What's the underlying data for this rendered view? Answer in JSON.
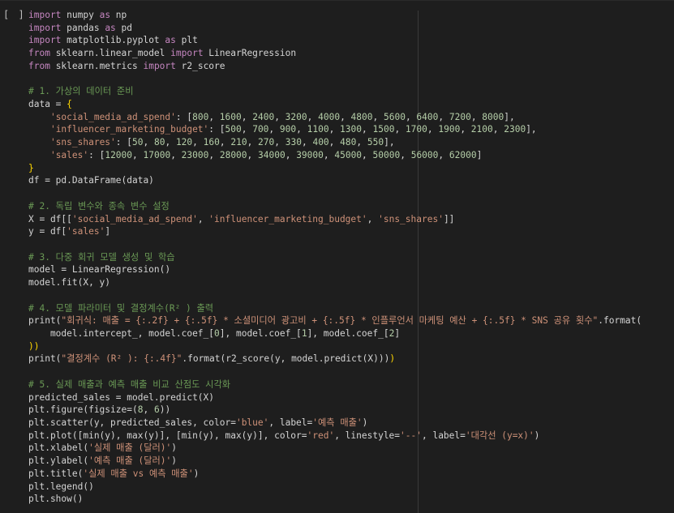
{
  "cell": {
    "run_indicator": "[ ]"
  },
  "code_lines": [
    [
      {
        "t": "import",
        "c": "kw"
      },
      {
        "t": " numpy ",
        "c": "pun"
      },
      {
        "t": "as",
        "c": "kw"
      },
      {
        "t": " np",
        "c": "pun"
      }
    ],
    [
      {
        "t": "import",
        "c": "kw"
      },
      {
        "t": " pandas ",
        "c": "pun"
      },
      {
        "t": "as",
        "c": "kw"
      },
      {
        "t": " pd",
        "c": "pun"
      }
    ],
    [
      {
        "t": "import",
        "c": "kw"
      },
      {
        "t": " matplotlib.pyplot ",
        "c": "pun"
      },
      {
        "t": "as",
        "c": "kw"
      },
      {
        "t": " plt",
        "c": "pun"
      }
    ],
    [
      {
        "t": "from",
        "c": "kw"
      },
      {
        "t": " sklearn.linear_model ",
        "c": "pun"
      },
      {
        "t": "import",
        "c": "kw"
      },
      {
        "t": " LinearRegression",
        "c": "pun"
      }
    ],
    [
      {
        "t": "from",
        "c": "kw"
      },
      {
        "t": " sklearn.metrics ",
        "c": "pun"
      },
      {
        "t": "import",
        "c": "kw"
      },
      {
        "t": " r2_score",
        "c": "pun"
      }
    ],
    [],
    [
      {
        "t": "# 1. 가상의 데이터 준비",
        "c": "com"
      }
    ],
    [
      {
        "t": "data = ",
        "c": "pun"
      },
      {
        "t": "{",
        "c": "br"
      }
    ],
    [
      {
        "t": "    ",
        "c": "pun"
      },
      {
        "t": "'social_media_ad_spend'",
        "c": "str"
      },
      {
        "t": ": [",
        "c": "pun"
      },
      {
        "t": "800",
        "c": "num"
      },
      {
        "t": ", ",
        "c": "pun"
      },
      {
        "t": "1600",
        "c": "num"
      },
      {
        "t": ", ",
        "c": "pun"
      },
      {
        "t": "2400",
        "c": "num"
      },
      {
        "t": ", ",
        "c": "pun"
      },
      {
        "t": "3200",
        "c": "num"
      },
      {
        "t": ", ",
        "c": "pun"
      },
      {
        "t": "4000",
        "c": "num"
      },
      {
        "t": ", ",
        "c": "pun"
      },
      {
        "t": "4800",
        "c": "num"
      },
      {
        "t": ", ",
        "c": "pun"
      },
      {
        "t": "5600",
        "c": "num"
      },
      {
        "t": ", ",
        "c": "pun"
      },
      {
        "t": "6400",
        "c": "num"
      },
      {
        "t": ", ",
        "c": "pun"
      },
      {
        "t": "7200",
        "c": "num"
      },
      {
        "t": ", ",
        "c": "pun"
      },
      {
        "t": "8000",
        "c": "num"
      },
      {
        "t": "],",
        "c": "pun"
      }
    ],
    [
      {
        "t": "    ",
        "c": "pun"
      },
      {
        "t": "'influencer_marketing_budget'",
        "c": "str"
      },
      {
        "t": ": [",
        "c": "pun"
      },
      {
        "t": "500",
        "c": "num"
      },
      {
        "t": ", ",
        "c": "pun"
      },
      {
        "t": "700",
        "c": "num"
      },
      {
        "t": ", ",
        "c": "pun"
      },
      {
        "t": "900",
        "c": "num"
      },
      {
        "t": ", ",
        "c": "pun"
      },
      {
        "t": "1100",
        "c": "num"
      },
      {
        "t": ", ",
        "c": "pun"
      },
      {
        "t": "1300",
        "c": "num"
      },
      {
        "t": ", ",
        "c": "pun"
      },
      {
        "t": "1500",
        "c": "num"
      },
      {
        "t": ", ",
        "c": "pun"
      },
      {
        "t": "1700",
        "c": "num"
      },
      {
        "t": ", ",
        "c": "pun"
      },
      {
        "t": "1900",
        "c": "num"
      },
      {
        "t": ", ",
        "c": "pun"
      },
      {
        "t": "2100",
        "c": "num"
      },
      {
        "t": ", ",
        "c": "pun"
      },
      {
        "t": "2300",
        "c": "num"
      },
      {
        "t": "],",
        "c": "pun"
      }
    ],
    [
      {
        "t": "    ",
        "c": "pun"
      },
      {
        "t": "'sns_shares'",
        "c": "str"
      },
      {
        "t": ": [",
        "c": "pun"
      },
      {
        "t": "50",
        "c": "num"
      },
      {
        "t": ", ",
        "c": "pun"
      },
      {
        "t": "80",
        "c": "num"
      },
      {
        "t": ", ",
        "c": "pun"
      },
      {
        "t": "120",
        "c": "num"
      },
      {
        "t": ", ",
        "c": "pun"
      },
      {
        "t": "160",
        "c": "num"
      },
      {
        "t": ", ",
        "c": "pun"
      },
      {
        "t": "210",
        "c": "num"
      },
      {
        "t": ", ",
        "c": "pun"
      },
      {
        "t": "270",
        "c": "num"
      },
      {
        "t": ", ",
        "c": "pun"
      },
      {
        "t": "330",
        "c": "num"
      },
      {
        "t": ", ",
        "c": "pun"
      },
      {
        "t": "400",
        "c": "num"
      },
      {
        "t": ", ",
        "c": "pun"
      },
      {
        "t": "480",
        "c": "num"
      },
      {
        "t": ", ",
        "c": "pun"
      },
      {
        "t": "550",
        "c": "num"
      },
      {
        "t": "],",
        "c": "pun"
      }
    ],
    [
      {
        "t": "    ",
        "c": "pun"
      },
      {
        "t": "'sales'",
        "c": "str"
      },
      {
        "t": ": [",
        "c": "pun"
      },
      {
        "t": "12000",
        "c": "num"
      },
      {
        "t": ", ",
        "c": "pun"
      },
      {
        "t": "17000",
        "c": "num"
      },
      {
        "t": ", ",
        "c": "pun"
      },
      {
        "t": "23000",
        "c": "num"
      },
      {
        "t": ", ",
        "c": "pun"
      },
      {
        "t": "28000",
        "c": "num"
      },
      {
        "t": ", ",
        "c": "pun"
      },
      {
        "t": "34000",
        "c": "num"
      },
      {
        "t": ", ",
        "c": "pun"
      },
      {
        "t": "39000",
        "c": "num"
      },
      {
        "t": ", ",
        "c": "pun"
      },
      {
        "t": "45000",
        "c": "num"
      },
      {
        "t": ", ",
        "c": "pun"
      },
      {
        "t": "50000",
        "c": "num"
      },
      {
        "t": ", ",
        "c": "pun"
      },
      {
        "t": "56000",
        "c": "num"
      },
      {
        "t": ", ",
        "c": "pun"
      },
      {
        "t": "62000",
        "c": "num"
      },
      {
        "t": "]",
        "c": "pun"
      }
    ],
    [
      {
        "t": "}",
        "c": "br"
      }
    ],
    [
      {
        "t": "df = pd.DataFrame(data)",
        "c": "pun"
      }
    ],
    [],
    [
      {
        "t": "# 2. 독립 변수와 종속 변수 설정",
        "c": "com"
      }
    ],
    [
      {
        "t": "X = df[[",
        "c": "pun"
      },
      {
        "t": "'social_media_ad_spend'",
        "c": "str"
      },
      {
        "t": ", ",
        "c": "pun"
      },
      {
        "t": "'influencer_marketing_budget'",
        "c": "str"
      },
      {
        "t": ", ",
        "c": "pun"
      },
      {
        "t": "'sns_shares'",
        "c": "str"
      },
      {
        "t": "]]",
        "c": "pun"
      }
    ],
    [
      {
        "t": "y = df[",
        "c": "pun"
      },
      {
        "t": "'sales'",
        "c": "str"
      },
      {
        "t": "]",
        "c": "pun"
      }
    ],
    [],
    [
      {
        "t": "# 3. 다중 회귀 모델 생성 및 학습",
        "c": "com"
      }
    ],
    [
      {
        "t": "model = LinearRegression()",
        "c": "pun"
      }
    ],
    [
      {
        "t": "model.fit(X, y)",
        "c": "pun"
      }
    ],
    [],
    [
      {
        "t": "# 4. 모델 파라미터 및 결정계수(R² ) 출력",
        "c": "com"
      }
    ],
    [
      {
        "t": "print(",
        "c": "pun"
      },
      {
        "t": "\"회귀식: 매출 = {:.2f} + {:.5f} * 소셜미디어 광고비 + {:.5f} * 인플루언서 마케팅 예산 + {:.5f} * SNS 공유 횟수\"",
        "c": "str"
      },
      {
        "t": ".format(",
        "c": "pun"
      }
    ],
    [
      {
        "t": "    model.intercept_, model.coef_[",
        "c": "pun"
      },
      {
        "t": "0",
        "c": "num"
      },
      {
        "t": "], model.coef_[",
        "c": "pun"
      },
      {
        "t": "1",
        "c": "num"
      },
      {
        "t": "], model.coef_[",
        "c": "pun"
      },
      {
        "t": "2",
        "c": "num"
      },
      {
        "t": "]",
        "c": "pun"
      }
    ],
    [
      {
        "t": "))",
        "c": "br"
      }
    ],
    [
      {
        "t": "print(",
        "c": "pun"
      },
      {
        "t": "\"결정계수 (R² ): {:.4f}\"",
        "c": "str"
      },
      {
        "t": ".format(r2_score(y, model.predict(X)))",
        "c": "pun"
      },
      {
        "t": ")",
        "c": "br"
      }
    ],
    [],
    [
      {
        "t": "# 5. 실제 매출과 예측 매출 비교 산점도 시각화",
        "c": "com"
      }
    ],
    [
      {
        "t": "predicted_sales = model.predict(X)",
        "c": "pun"
      }
    ],
    [
      {
        "t": "plt.figure(figsize=(",
        "c": "pun"
      },
      {
        "t": "8",
        "c": "num"
      },
      {
        "t": ", ",
        "c": "pun"
      },
      {
        "t": "6",
        "c": "num"
      },
      {
        "t": "))",
        "c": "pun"
      }
    ],
    [
      {
        "t": "plt.scatter(y, predicted_sales, color=",
        "c": "pun"
      },
      {
        "t": "'blue'",
        "c": "str"
      },
      {
        "t": ", label=",
        "c": "pun"
      },
      {
        "t": "'예측 매출'",
        "c": "str"
      },
      {
        "t": ")",
        "c": "pun"
      }
    ],
    [
      {
        "t": "plt.plot([min(y), max(y)], [min(y), max(y)], color=",
        "c": "pun"
      },
      {
        "t": "'red'",
        "c": "str"
      },
      {
        "t": ", linestyle=",
        "c": "pun"
      },
      {
        "t": "'--'",
        "c": "str"
      },
      {
        "t": ", label=",
        "c": "pun"
      },
      {
        "t": "'대각선 (y=x)'",
        "c": "str"
      },
      {
        "t": ")",
        "c": "pun"
      }
    ],
    [
      {
        "t": "plt.xlabel(",
        "c": "pun"
      },
      {
        "t": "'실제 매출 (달러)'",
        "c": "str"
      },
      {
        "t": ")",
        "c": "pun"
      }
    ],
    [
      {
        "t": "plt.ylabel(",
        "c": "pun"
      },
      {
        "t": "'예측 매출 (달러)'",
        "c": "str"
      },
      {
        "t": ")",
        "c": "pun"
      }
    ],
    [
      {
        "t": "plt.title(",
        "c": "pun"
      },
      {
        "t": "'실제 매출 vs 예측 매출'",
        "c": "str"
      },
      {
        "t": ")",
        "c": "pun"
      }
    ],
    [
      {
        "t": "plt.legend()",
        "c": "pun"
      }
    ],
    [
      {
        "t": "plt.show()",
        "c": "pun"
      }
    ]
  ]
}
